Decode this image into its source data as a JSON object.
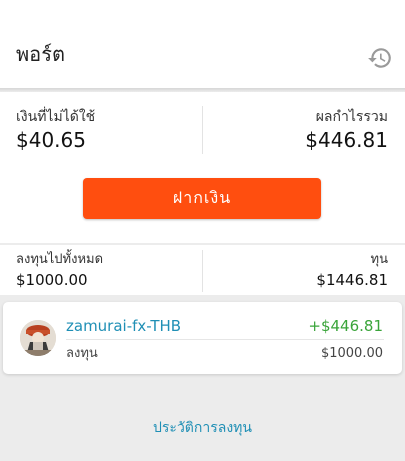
{
  "header": {
    "title": "พอร์ต",
    "history_icon": "history-icon"
  },
  "summary": {
    "available_cash_label": "เงินที่ไม่ได้ใช้",
    "available_cash_value": "$40.65",
    "total_profit_label": "ผลกำไรรวม",
    "total_profit_value": "$446.81",
    "deposit_label": "ฝากเงิน"
  },
  "totals": {
    "total_invested_label": "ลงทุนไปทั้งหมด",
    "total_invested_value": "$1000.00",
    "capital_label": "ทุน",
    "capital_value": "$1446.81"
  },
  "portfolios": [
    {
      "name": "zamurai-fx-THB",
      "profit": "+$446.81",
      "invested_label": "ลงทุน",
      "invested_value": "$1000.00"
    }
  ],
  "footer": {
    "history_link": "ประวัติการลงทุน"
  },
  "colors": {
    "accent": "#ff4e0f",
    "link": "#1f8fb5",
    "profit": "#3aa43a",
    "background": "#ececec"
  }
}
